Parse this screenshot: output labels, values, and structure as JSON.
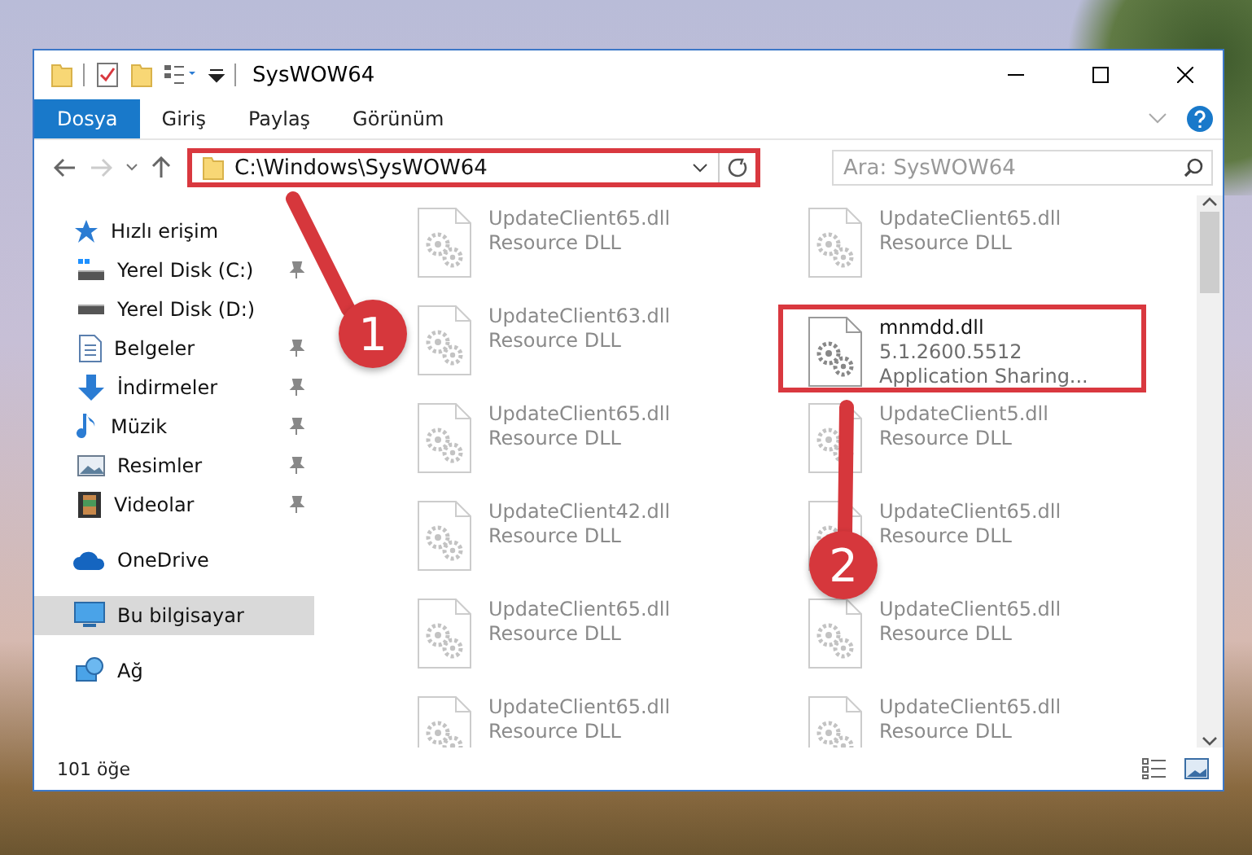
{
  "window": {
    "title": "SysWOW64"
  },
  "ribbon_tabs": [
    {
      "label": "Dosya",
      "kind": "file_menu"
    },
    {
      "label": "Giriş",
      "kind": "tab"
    },
    {
      "label": "Paylaş",
      "kind": "tab"
    },
    {
      "label": "Görünüm",
      "kind": "tab"
    }
  ],
  "address_bar": {
    "path": "C:\\Windows\\SysWOW64",
    "highlighted": true
  },
  "navigation": {
    "forward_disabled": true
  },
  "search": {
    "placeholder": "Ara: SysWOW64"
  },
  "sidebar": {
    "items": [
      {
        "label": "Hızlı erişim",
        "kind": "quick_access",
        "selected": false,
        "children": [
          {
            "label": "Yerel Disk (C:)",
            "kind": "drive_c",
            "pinned": true,
            "selected": false
          },
          {
            "label": "Yerel Disk (D:)",
            "kind": "drive",
            "pinned": false,
            "selected": false
          },
          {
            "label": "Belgeler",
            "kind": "documents",
            "pinned": true,
            "selected": false
          },
          {
            "label": "İndirmeler",
            "kind": "downloads",
            "pinned": true,
            "selected": false
          },
          {
            "label": "Müzik",
            "kind": "music",
            "pinned": true,
            "selected": false
          },
          {
            "label": "Resimler",
            "kind": "pictures",
            "pinned": true,
            "selected": false
          },
          {
            "label": "Videolar",
            "kind": "videos",
            "pinned": true,
            "selected": false
          }
        ]
      },
      {
        "label": "OneDrive",
        "kind": "cloud",
        "selected": false
      },
      {
        "label": "Bu bilgisayar",
        "kind": "computer",
        "selected": true
      },
      {
        "label": "Ağ",
        "kind": "network",
        "selected": false
      }
    ]
  },
  "files": [
    {
      "name": "UpdateClient65.dll",
      "description": "Resource DLL",
      "faded": true,
      "highlighted": false
    },
    {
      "name": "UpdateClient65.dll",
      "description": "Resource DLL",
      "faded": true,
      "highlighted": false
    },
    {
      "name": "UpdateClient63.dll",
      "description": "Resource DLL",
      "faded": true,
      "highlighted": false
    },
    {
      "name": "mnmdd.dll",
      "version": "5.1.2600.5512",
      "description": "Application Sharing...",
      "faded": false,
      "highlighted": true
    },
    {
      "name": "UpdateClient65.dll",
      "description": "Resource DLL",
      "faded": true,
      "highlighted": false
    },
    {
      "name": "UpdateClient5.dll",
      "description": "Resource DLL",
      "faded": true,
      "highlighted": false
    },
    {
      "name": "UpdateClient42.dll",
      "description": "Resource DLL",
      "faded": true,
      "highlighted": false
    },
    {
      "name": "UpdateClient65.dll",
      "description": "Resource DLL",
      "faded": true,
      "highlighted": false
    },
    {
      "name": "UpdateClient65.dll",
      "description": "Resource DLL",
      "faded": true,
      "highlighted": false
    },
    {
      "name": "UpdateClient65.dll",
      "description": "Resource DLL",
      "faded": true,
      "highlighted": false
    },
    {
      "name": "UpdateClient65.dll",
      "description": "Resource DLL",
      "faded": true,
      "highlighted": false
    },
    {
      "name": "UpdateClient65.dll",
      "description": "Resource DLL",
      "faded": true,
      "highlighted": false
    }
  ],
  "status_bar": {
    "item_count": "101 öğe"
  },
  "annotations": [
    {
      "number": "1"
    },
    {
      "number": "2"
    }
  ]
}
